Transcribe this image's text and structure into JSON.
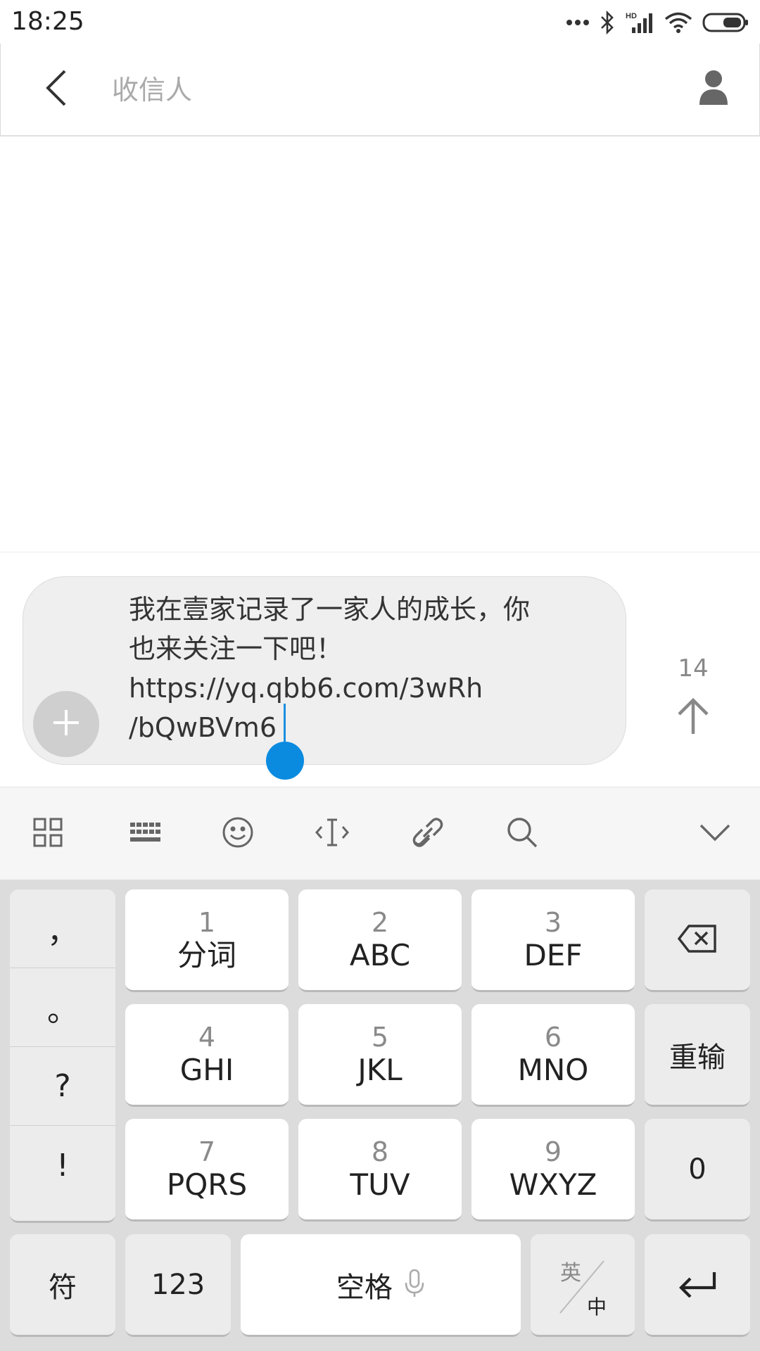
{
  "status_bar": {
    "time": "18:25",
    "icons": [
      "more-dots-icon",
      "bluetooth-icon",
      "hd-signal-icon",
      "wifi-icon",
      "battery-icon"
    ]
  },
  "app_bar": {
    "back_icon": "chevron-left-icon",
    "recipient_placeholder": "收信人",
    "contact_icon": "person-icon"
  },
  "compose": {
    "message": "我在壹家记录了一家人的成长，你\n也来关注一下吧！\nhttps://yq.qbb6.com/3wRh\n/bQwBVm6",
    "char_count": "14",
    "attach_icon": "plus-icon",
    "send_icon": "arrow-up-icon"
  },
  "keyboard_toolbar": {
    "tools": [
      "apps-grid-icon",
      "keyboard-icon",
      "emoji-icon",
      "text-cursor-icon",
      "link-icon",
      "search-icon"
    ],
    "collapse_icon": "chevron-down-icon"
  },
  "keyboard": {
    "punctuation": [
      "，",
      "。",
      "?",
      "!"
    ],
    "keys": [
      {
        "num": "1",
        "letters": "分词"
      },
      {
        "num": "2",
        "letters": "ABC"
      },
      {
        "num": "3",
        "letters": "DEF"
      },
      {
        "num": "4",
        "letters": "GHI"
      },
      {
        "num": "5",
        "letters": "JKL"
      },
      {
        "num": "6",
        "letters": "MNO"
      },
      {
        "num": "7",
        "letters": "PQRS"
      },
      {
        "num": "8",
        "letters": "TUV"
      },
      {
        "num": "9",
        "letters": "WXYZ"
      }
    ],
    "delete_icon": "backspace-icon",
    "reenter_label": "重输",
    "zero_label": "0",
    "symbols_label": "符",
    "numbers_label": "123",
    "space_label": "空格",
    "mic_icon": "microphone-icon",
    "lang_top": "英",
    "lang_bottom": "中",
    "enter_icon": "enter-icon"
  }
}
